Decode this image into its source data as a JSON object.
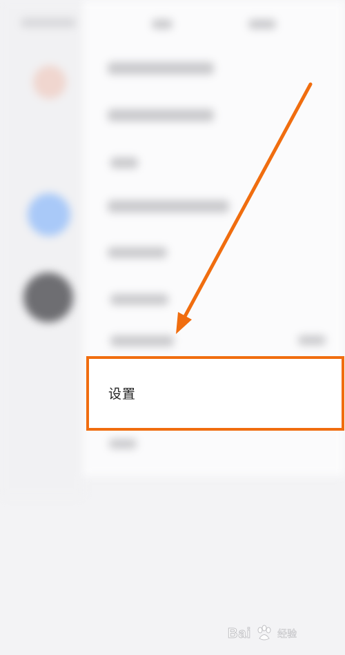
{
  "menu": {
    "settings_label": "设置"
  },
  "watermark": {
    "brand_text": "Bai",
    "brand_suffix": "经验"
  },
  "colors": {
    "highlight": "#f06d0f",
    "arrow": "#f06d0f",
    "background": "#f3f3f5",
    "panel": "#fbfbfc"
  },
  "icons": [
    "pointer-arrow-icon",
    "paw-icon"
  ]
}
